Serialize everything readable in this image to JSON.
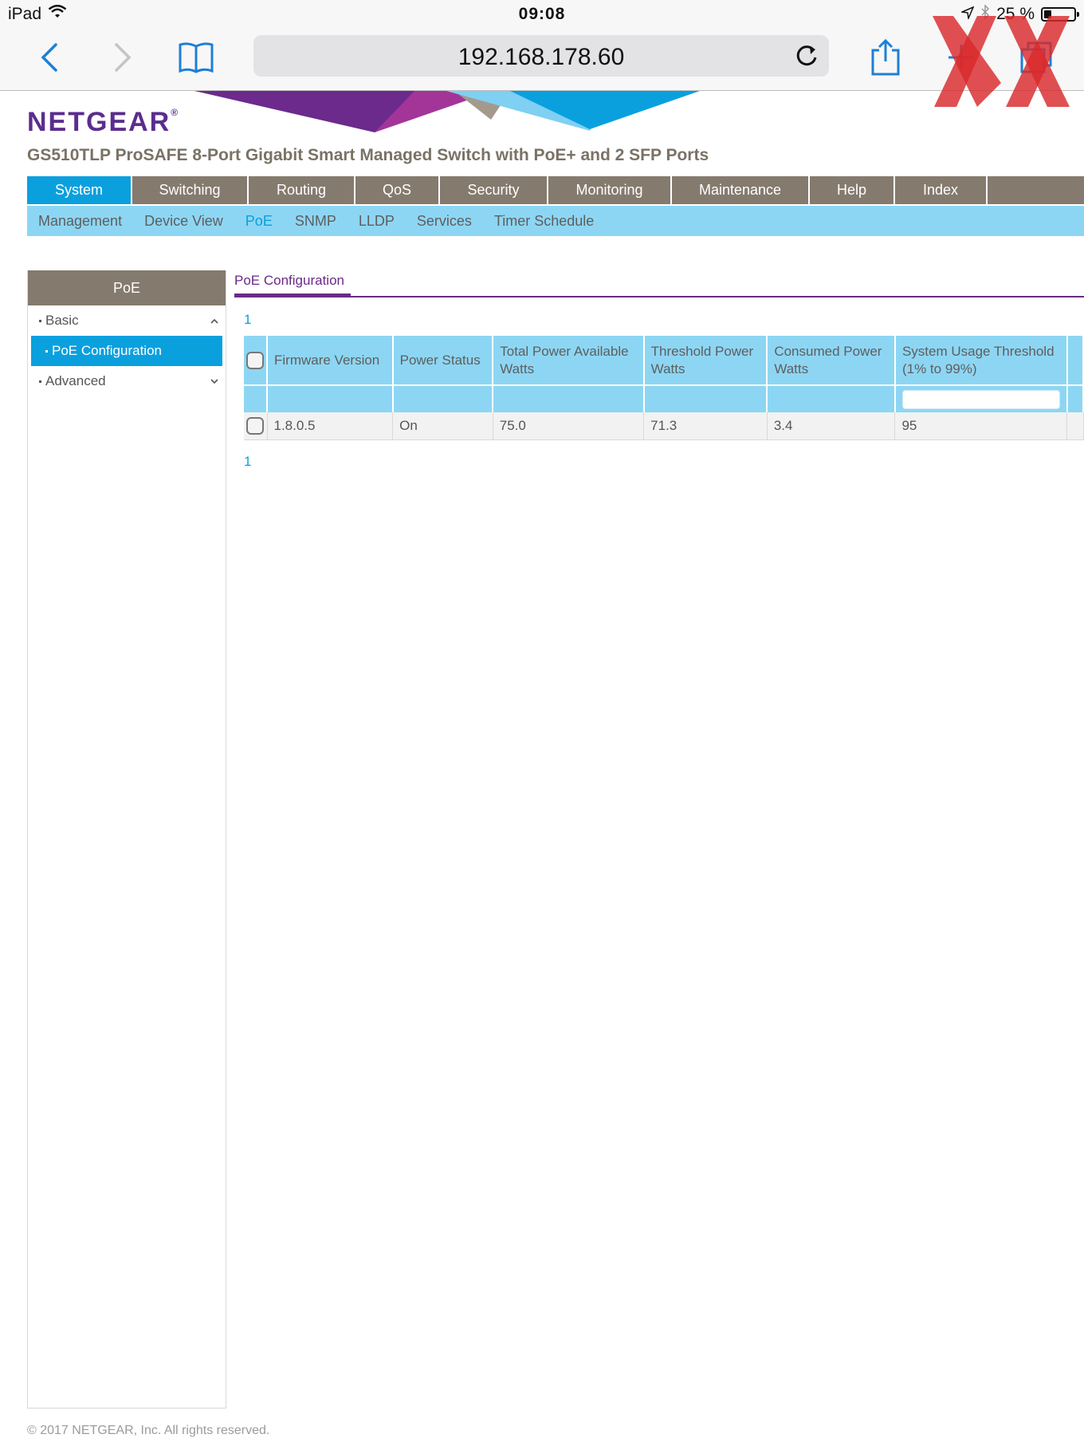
{
  "statusbar": {
    "device": "iPad",
    "time": "09:08",
    "battery_text": "25 %",
    "battery_level": 0.25
  },
  "browser": {
    "url": "192.168.178.60",
    "icons": [
      "back-icon",
      "forward-icon",
      "bookmarks-icon",
      "reload-icon",
      "share-icon",
      "new-tab-icon",
      "tabs-icon"
    ]
  },
  "brand": {
    "logo": "NETGEAR",
    "logo_mark": "®",
    "product_title": "GS510TLP ProSAFE 8-Port Gigabit Smart Managed Switch with PoE+ and 2 SFP Ports",
    "colors": {
      "purple": "#5b2d8e",
      "blue": "#0aa0de",
      "nav_gray": "#857a6e",
      "light_blue": "#8dd6f3"
    }
  },
  "mainnav": [
    {
      "label": "System",
      "active": true
    },
    {
      "label": "Switching"
    },
    {
      "label": "Routing"
    },
    {
      "label": "QoS"
    },
    {
      "label": "Security"
    },
    {
      "label": "Monitoring"
    },
    {
      "label": "Maintenance"
    },
    {
      "label": "Help"
    },
    {
      "label": "Index"
    }
  ],
  "subnav": [
    {
      "label": "Management"
    },
    {
      "label": "Device View"
    },
    {
      "label": "PoE",
      "active": true
    },
    {
      "label": "SNMP"
    },
    {
      "label": "LLDP"
    },
    {
      "label": "Services"
    },
    {
      "label": "Timer Schedule"
    }
  ],
  "sidebar": {
    "title": "PoE",
    "basic_label": "Basic",
    "active_item": "PoE Configuration",
    "advanced_label": "Advanced"
  },
  "content": {
    "tab": "PoE Configuration",
    "pager_top": "1",
    "pager_bottom": "1",
    "columns": [
      {
        "line1": "Firmware Version",
        "line2": ""
      },
      {
        "line1": "Power Status",
        "line2": ""
      },
      {
        "line1": "Total Power Available",
        "line2": "Watts"
      },
      {
        "line1": "Threshold Power",
        "line2": "Watts"
      },
      {
        "line1": "Consumed Power",
        "line2": "Watts"
      },
      {
        "line1": "System Usage Threshold",
        "line2": "(1% to 99%)"
      }
    ],
    "row": [
      "1.8.0.5",
      "On",
      "75.0",
      "71.3",
      "3.4",
      "95"
    ]
  },
  "footer": "© 2017 NETGEAR, Inc. All rights reserved."
}
